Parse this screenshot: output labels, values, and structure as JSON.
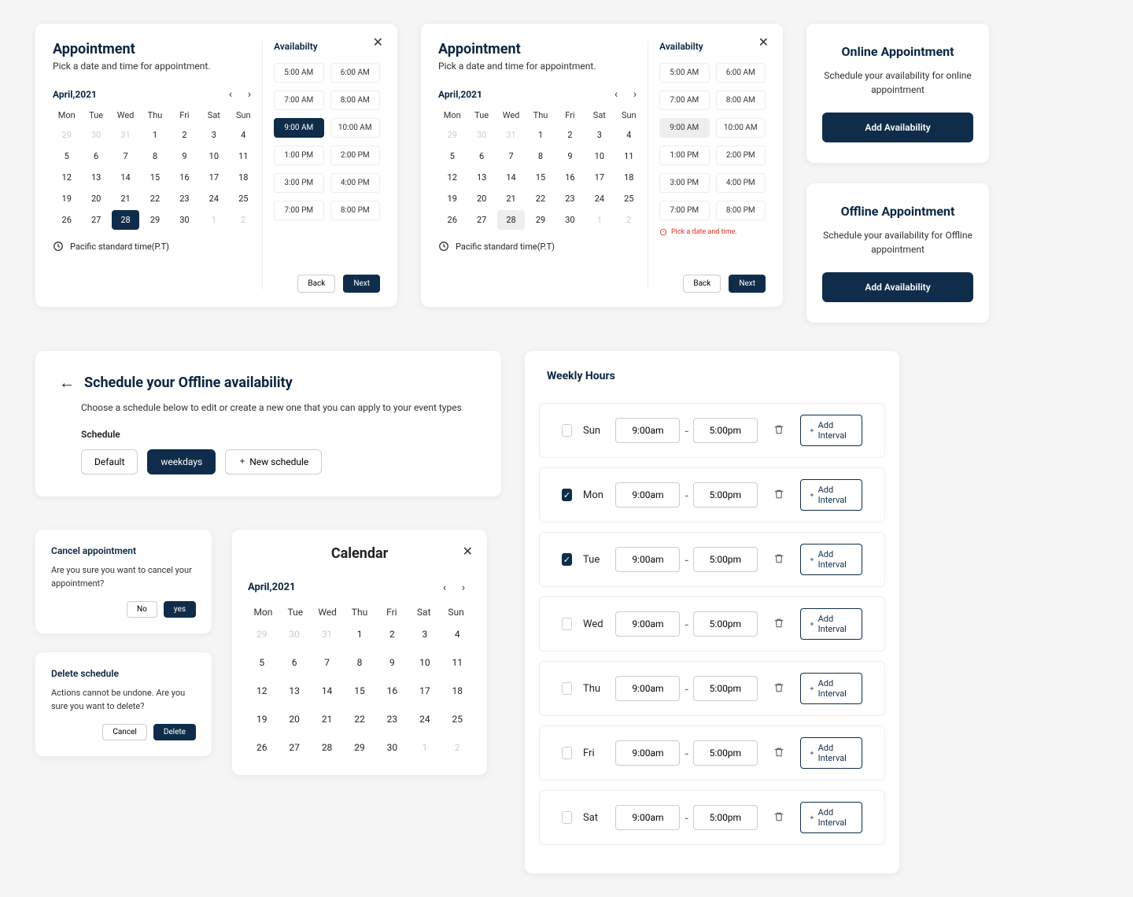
{
  "appointment": {
    "title": "Appointment",
    "subtitle": "Pick a date and time for appointment.",
    "month": "April,2021",
    "dow": [
      "Mon",
      "Tue",
      "Wed",
      "Thu",
      "Fri",
      "Sat",
      "Sun"
    ],
    "days": [
      {
        "d": "29",
        "muted": true
      },
      {
        "d": "30",
        "muted": true
      },
      {
        "d": "31",
        "muted": true
      },
      {
        "d": "1"
      },
      {
        "d": "2"
      },
      {
        "d": "3"
      },
      {
        "d": "4"
      },
      {
        "d": "5"
      },
      {
        "d": "6"
      },
      {
        "d": "7"
      },
      {
        "d": "8"
      },
      {
        "d": "9"
      },
      {
        "d": "10"
      },
      {
        "d": "11"
      },
      {
        "d": "12"
      },
      {
        "d": "13"
      },
      {
        "d": "14"
      },
      {
        "d": "15"
      },
      {
        "d": "16"
      },
      {
        "d": "17"
      },
      {
        "d": "18"
      },
      {
        "d": "19"
      },
      {
        "d": "20"
      },
      {
        "d": "21"
      },
      {
        "d": "22"
      },
      {
        "d": "23"
      },
      {
        "d": "24"
      },
      {
        "d": "25"
      },
      {
        "d": "26"
      },
      {
        "d": "27"
      },
      {
        "d": "28",
        "sel": true
      },
      {
        "d": "29"
      },
      {
        "d": "30"
      },
      {
        "d": "1",
        "muted": true
      },
      {
        "d": "2",
        "muted": true
      }
    ],
    "timezone": "Pacific standard time(P.T)",
    "availability_title": "Availabilty",
    "slots": [
      "5:00 AM",
      "6:00 AM",
      "7:00 AM",
      "8:00 AM",
      "9:00 AM",
      "10:00 AM",
      "1:00 PM",
      "2:00 PM",
      "3:00 PM",
      "4:00 PM",
      "7:00 PM",
      "8:00 PM"
    ],
    "selected_slot_dark": "9:00 AM",
    "error_text": "Pick a date and time.",
    "back": "Back",
    "next": "Next"
  },
  "side": {
    "online": {
      "title": "Online Appointment",
      "sub": "Schedule your availability for online appointment",
      "btn": "Add Availability"
    },
    "offline": {
      "title": "Offline Appointment",
      "sub": "Schedule your availability for Offline appointment",
      "btn": "Add Availability"
    }
  },
  "schedule": {
    "title": "Schedule your Offline availability",
    "sub": "Choose a schedule below to edit or create a new one that you can apply to your event types",
    "label": "Schedule",
    "chips": {
      "default": "Default",
      "weekdays": "weekdays",
      "new": "New schedule"
    }
  },
  "weekly": {
    "title": "Weekly Hours",
    "add_interval": "Add Interval",
    "rows": [
      {
        "day": "Sun",
        "on": false,
        "start": "9:00am",
        "end": "5:00pm"
      },
      {
        "day": "Mon",
        "on": true,
        "start": "9:00am",
        "end": "5:00pm"
      },
      {
        "day": "Tue",
        "on": true,
        "start": "9:00am",
        "end": "5:00pm"
      },
      {
        "day": "Wed",
        "on": false,
        "start": "9:00am",
        "end": "5:00pm"
      },
      {
        "day": "Thu",
        "on": false,
        "start": "9:00am",
        "end": "5:00pm"
      },
      {
        "day": "Fri",
        "on": false,
        "start": "9:00am",
        "end": "5:00pm"
      },
      {
        "day": "Sat",
        "on": false,
        "start": "9:00am",
        "end": "5:00pm"
      }
    ]
  },
  "dialogs": {
    "cancel": {
      "title": "Cancel appointment",
      "body": "Are you sure you want to cancel your appointment?",
      "no": "No",
      "yes": "yes"
    },
    "delete": {
      "title": "Delete schedule",
      "body": "Actions cannot be undone. Are you sure you want to delete?",
      "cancel": "Cancel",
      "delete": "Delete"
    }
  },
  "calendar": {
    "title": "Calendar",
    "month": "April,2021"
  }
}
